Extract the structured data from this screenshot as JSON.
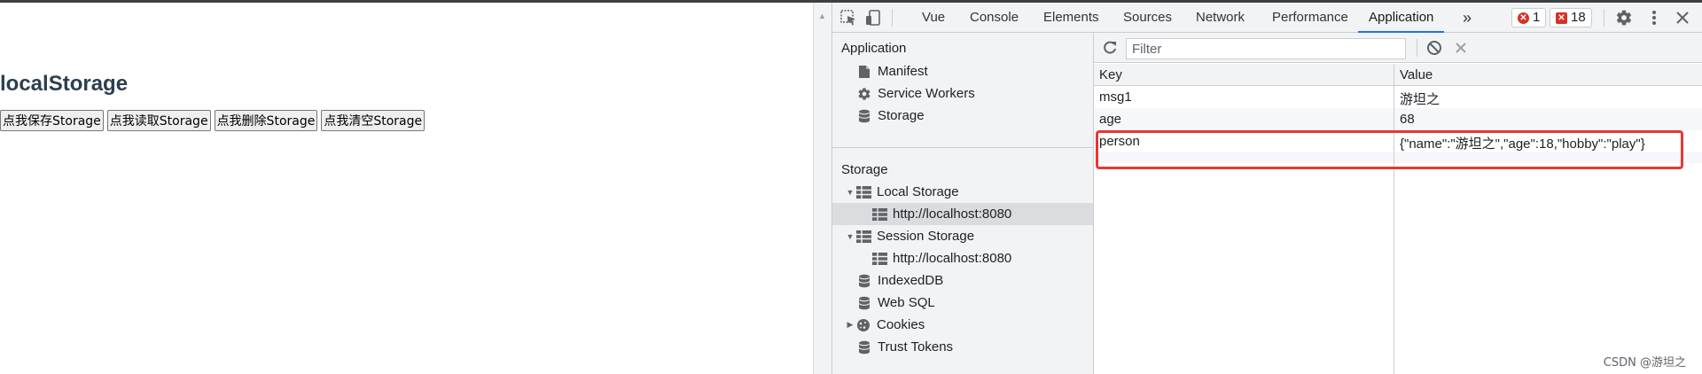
{
  "page": {
    "heading": "localStorage",
    "buttons": [
      "点我保存Storage",
      "点我读取Storage",
      "点我删除Storage",
      "点我清空Storage"
    ]
  },
  "devtools": {
    "tabs": [
      "Vue",
      "Console",
      "Elements",
      "Sources",
      "Network",
      "Performance",
      "Application"
    ],
    "active_tab": "Application",
    "more_tabs": "»",
    "error_count": "1",
    "issue_count": "18",
    "sidebar": {
      "application_title": "Application",
      "application_items": [
        "Manifest",
        "Service Workers",
        "Storage"
      ],
      "storage_title": "Storage",
      "storage_items": {
        "local_storage": "Local Storage",
        "local_origin": "http://localhost:8080",
        "session_storage": "Session Storage",
        "session_origin": "http://localhost:8080",
        "indexeddb": "IndexedDB",
        "websql": "Web SQL",
        "cookies": "Cookies",
        "trust_tokens": "Trust Tokens"
      }
    },
    "toolbar": {
      "filter_placeholder": "Filter"
    },
    "table": {
      "headers": {
        "key": "Key",
        "value": "Value"
      },
      "rows": [
        {
          "key": "msg1",
          "value": "游坦之"
        },
        {
          "key": "age",
          "value": "68"
        },
        {
          "key": "person",
          "value": "{\"name\":\"游坦之\",\"age\":18,\"hobby\":\"play\"}"
        }
      ]
    }
  },
  "watermark": "CSDN @游坦之",
  "colors": {
    "accent": "#1a73e8",
    "error": "#d93025",
    "highlight": "#e53935"
  },
  "icons": [
    "inspect-icon",
    "device-icon",
    "gear-icon",
    "kebab-menu-icon",
    "close-icon",
    "refresh-icon",
    "clear-icon",
    "delete-icon",
    "file-icon",
    "cog-icon",
    "database-icon",
    "table-grid-icon",
    "cookie-icon"
  ]
}
